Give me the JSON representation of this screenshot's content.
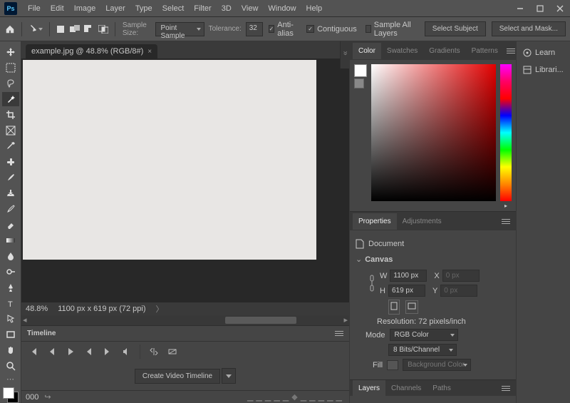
{
  "menu": [
    "File",
    "Edit",
    "Image",
    "Layer",
    "Type",
    "Select",
    "Filter",
    "3D",
    "View",
    "Window",
    "Help"
  ],
  "optionsBar": {
    "sampleSizeLabel": "Sample Size:",
    "sampleSize": "Point Sample",
    "toleranceLabel": "Tolerance:",
    "tolerance": "32",
    "antiAlias": "Anti-alias",
    "contiguous": "Contiguous",
    "sampleAllLayers": "Sample All Layers",
    "selectSubject": "Select Subject",
    "selectAndMask": "Select and Mask..."
  },
  "document": {
    "tab": "example.jpg @ 48.8% (RGB/8#)",
    "zoom": "48.8%",
    "dims": "1100 px x 619 px (72 ppi)"
  },
  "timeline": {
    "title": "Timeline",
    "create": "Create Video Timeline",
    "footLabel": "000"
  },
  "colorPanel": {
    "tabs": [
      "Color",
      "Swatches",
      "Gradients",
      "Patterns"
    ]
  },
  "propsPanel": {
    "tabs": [
      "Properties",
      "Adjustments"
    ],
    "docLabel": "Document",
    "canvasLabel": "Canvas",
    "W": "W",
    "Wval": "1100 px",
    "X": "X",
    "Xval": "0 px",
    "H": "H",
    "Hval": "619 px",
    "Y": "Y",
    "Yval": "0 px",
    "resolution": "Resolution: 72 pixels/inch",
    "modeLabel": "Mode",
    "modeVal": "RGB Color",
    "depthVal": "8 Bits/Channel",
    "fillLabel": "Fill",
    "fillVal": "Background Color"
  },
  "layersPanel": {
    "tabs": [
      "Layers",
      "Channels",
      "Paths"
    ]
  },
  "dock": {
    "learn": "Learn",
    "libraries": "Librari..."
  }
}
